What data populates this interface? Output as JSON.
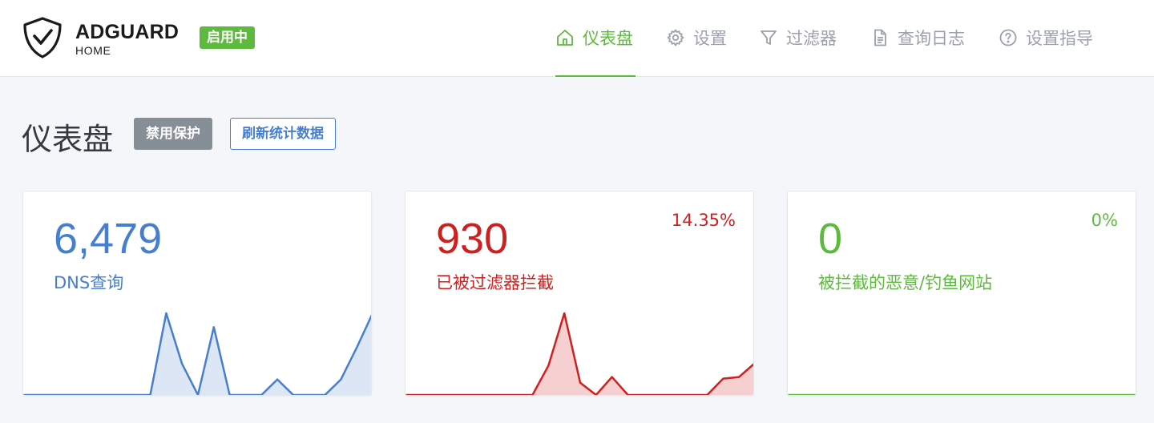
{
  "header": {
    "brand_name": "ADGUARD",
    "brand_sub": "HOME",
    "status_badge": "启用中",
    "nav": [
      {
        "label": "仪表盘",
        "icon": "home-icon",
        "active": true
      },
      {
        "label": "设置",
        "icon": "gear-icon",
        "active": false
      },
      {
        "label": "过滤器",
        "icon": "filter-icon",
        "active": false
      },
      {
        "label": "查询日志",
        "icon": "document-icon",
        "active": false
      },
      {
        "label": "设置指导",
        "icon": "help-circle-icon",
        "active": false
      }
    ]
  },
  "main": {
    "title": "仪表盘",
    "disable_button": "禁用保护",
    "refresh_button": "刷新统计数据"
  },
  "colors": {
    "accent_green": "#5eba3e",
    "blue": "#467fcf",
    "red": "#cd201f",
    "gray_button": "#868e96"
  },
  "cards": [
    {
      "value": "6,479",
      "label": "DNS查询",
      "percent": "",
      "color": "#467fcf",
      "fill": "#dce6f5",
      "series": [
        0,
        0,
        0,
        0,
        0,
        0,
        0,
        0,
        0,
        1,
        0.38,
        0,
        0.83,
        0,
        0,
        0,
        0.19,
        0,
        0,
        0,
        0.19,
        0.58,
        1
      ]
    },
    {
      "value": "930",
      "label": "已被过滤器拦截",
      "percent": "14.35%",
      "color": "#cd201f",
      "fill": "#f6d0d0",
      "series": [
        0,
        0,
        0,
        0,
        0,
        0,
        0,
        0,
        0,
        0.36,
        1,
        0.15,
        0,
        0.22,
        0,
        0,
        0,
        0,
        0,
        0,
        0.2,
        0.22,
        0.39
      ]
    },
    {
      "value": "0",
      "label": "被拦截的恶意/钓鱼网站",
      "percent": "0%",
      "color": "#5eba3e",
      "fill": "#ddf0d6",
      "series": [
        0,
        0,
        0,
        0,
        0,
        0,
        0,
        0,
        0,
        0,
        0,
        0,
        0,
        0,
        0,
        0,
        0,
        0,
        0,
        0,
        0,
        0,
        0
      ]
    }
  ]
}
